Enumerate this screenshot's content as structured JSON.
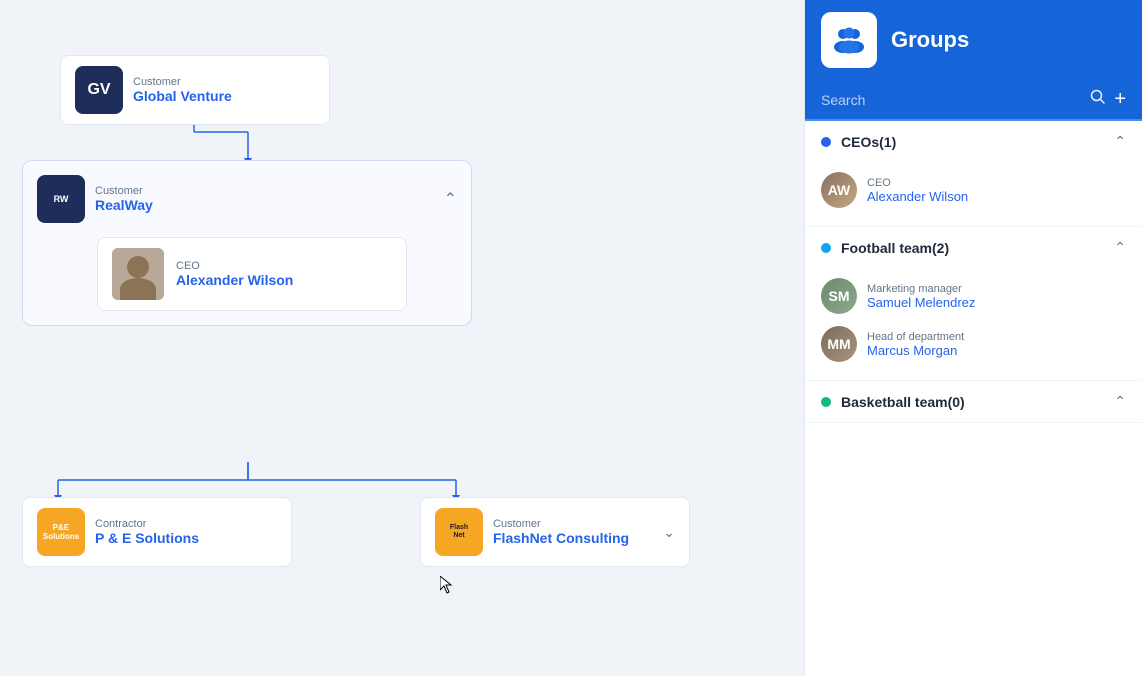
{
  "leftPanel": {
    "nodes": {
      "globalVenture": {
        "type": "Customer",
        "name": "Global Venture",
        "logo": "GV"
      },
      "realWay": {
        "type": "Customer",
        "name": "RealWay",
        "expanded": true,
        "ceo": {
          "role": "CEO",
          "name": "Alexander Wilson"
        }
      },
      "peS": {
        "type": "Contractor",
        "name": "P & E Solutions",
        "logo": "P&E Solutions"
      },
      "flashNet": {
        "type": "Customer",
        "name": "FlashNet Consulting",
        "logo": "FlashNet"
      }
    }
  },
  "rightPanel": {
    "header": {
      "title": "Groups",
      "iconLabel": "groups-icon"
    },
    "search": {
      "placeholder": "Search"
    },
    "addButtonLabel": "+",
    "searchButtonLabel": "🔍",
    "groups": [
      {
        "id": "ceos",
        "name": "CEOs(1)",
        "dotColor": "#2563eb",
        "expanded": true,
        "members": [
          {
            "role": "CEO",
            "name": "Alexander Wilson",
            "avatarKey": "av-alexander"
          }
        ]
      },
      {
        "id": "football",
        "name": "Football team(2)",
        "dotColor": "#0ea5e9",
        "expanded": true,
        "members": [
          {
            "role": "Marketing manager",
            "name": "Samuel Melendrez",
            "avatarKey": "av-samuel"
          },
          {
            "role": "Head of department",
            "name": "Marcus Morgan",
            "avatarKey": "av-marcus"
          }
        ]
      },
      {
        "id": "basketball",
        "name": "Basketball team(0)",
        "dotColor": "#10b981",
        "expanded": true,
        "members": []
      }
    ]
  }
}
